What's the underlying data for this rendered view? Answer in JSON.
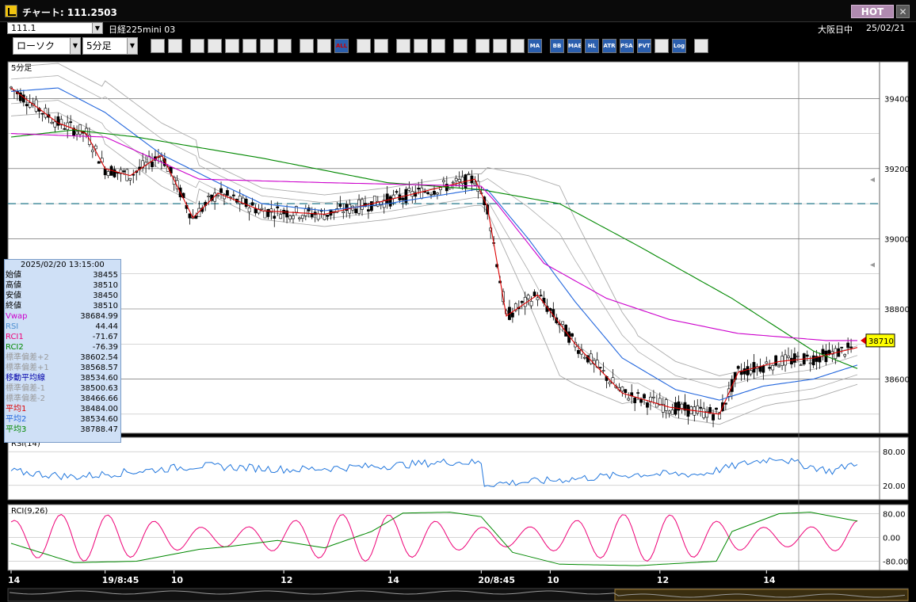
{
  "window": {
    "title": "チャート: 111.2503",
    "hot_label": "HOT",
    "close_label": "✕"
  },
  "info": {
    "symbol": "111.1",
    "contract": "日経225mini 03",
    "session": "大阪日中",
    "date": "25/02/21"
  },
  "toolbar": {
    "chart_type": "ローソク",
    "interval": "5分足",
    "buttons": [
      "zoom",
      "window",
      "draw-line",
      "link",
      "cursor",
      "arrow",
      "list",
      "trash",
      "move-left",
      "move-right",
      "ALL",
      "pin",
      "search",
      "compare",
      "plus",
      "blank",
      "settings",
      "wrench",
      "palette",
      "indicators",
      "MA",
      "BB",
      "MAE",
      "HL",
      "ATR",
      "PSAR",
      "PVT",
      "frame",
      "Log",
      "export"
    ],
    "button_labels": {
      "all": "ALL",
      "ma": "MA",
      "bb": "BB",
      "mae": "MAE",
      "hl": "HL",
      "atr": "ATR",
      "psar": "PSAR",
      "pvt": "PVT",
      "log": "Log"
    }
  },
  "colors": {
    "candle_up": "#ffffff",
    "candle_down": "#000000",
    "vwap": "#cc00cc",
    "ma1": "#dd0000",
    "ma2": "#2266dd",
    "ma3": "#008800",
    "bands": "#aaaaaa",
    "rsi": "#2277dd",
    "rci1": "#ee0077",
    "rci2": "#008800",
    "dashed_line": "#227788",
    "price_tag": "#ffff00"
  },
  "panels": {
    "main_label": "5分足",
    "rsi_label": "RSI(14)",
    "rci_label": "RCI(9,26)"
  },
  "price_tag": "38710",
  "info_panel": {
    "datetime": "2025/02/20  13:15:00",
    "rows": [
      {
        "label": "始値",
        "value": "38455",
        "color": "#000000"
      },
      {
        "label": "高値",
        "value": "38510",
        "color": "#000000"
      },
      {
        "label": "安値",
        "value": "38450",
        "color": "#000000"
      },
      {
        "label": "終値",
        "value": "38510",
        "color": "#000000"
      },
      {
        "label": "Vwap",
        "value": "38684.99",
        "color": "#cc00cc"
      },
      {
        "label": "RSI",
        "value": "44.44",
        "color": "#4c8fd0"
      },
      {
        "label": "RCI1",
        "value": "-71.67",
        "color": "#ee0077"
      },
      {
        "label": "RCI2",
        "value": "-76.39",
        "color": "#008800"
      },
      {
        "label": "標準偏差+2",
        "value": "38602.54",
        "color": "#999999"
      },
      {
        "label": "標準偏差+1",
        "value": "38568.57",
        "color": "#999999"
      },
      {
        "label": "移動平均線",
        "value": "38534.60",
        "color": "#0000aa"
      },
      {
        "label": "標準偏差-1",
        "value": "38500.63",
        "color": "#999999"
      },
      {
        "label": "標準偏差-2",
        "value": "38466.66",
        "color": "#999999"
      },
      {
        "label": "平均1",
        "value": "38484.00",
        "color": "#dd0000"
      },
      {
        "label": "平均2",
        "value": "38534.60",
        "color": "#2266dd"
      },
      {
        "label": "平均3",
        "value": "38788.47",
        "color": "#008800"
      }
    ]
  },
  "chart_data": [
    {
      "type": "candlestick",
      "title": "5分足",
      "ylim": [
        38450,
        39500
      ],
      "yticks": [
        "39400",
        "39200",
        "39000",
        "38800",
        "38600"
      ],
      "ytick_values": [
        39400,
        39200,
        39000,
        38800,
        38600
      ],
      "horizontal_line": 39100,
      "xtick_labels": [
        "14",
        "19/8:45",
        "10",
        "12",
        "14",
        "20/8:45",
        "10",
        "12",
        "14"
      ],
      "xtick_bar_index": [
        0,
        30,
        52,
        87,
        121,
        150,
        172,
        207,
        241
      ],
      "series": [
        {
          "name": "平均1",
          "color": "#dd0000",
          "anchors": [
            [
              0,
              39430
            ],
            [
              15,
              39330
            ],
            [
              24,
              39300
            ],
            [
              30,
              39200
            ],
            [
              38,
              39180
            ],
            [
              48,
              39240
            ],
            [
              58,
              39060
            ],
            [
              66,
              39130
            ],
            [
              80,
              39080
            ],
            [
              100,
              39070
            ],
            [
              120,
              39110
            ],
            [
              148,
              39170
            ],
            [
              152,
              39090
            ],
            [
              158,
              38780
            ],
            [
              168,
              38840
            ],
            [
              180,
              38700
            ],
            [
              195,
              38560
            ],
            [
              210,
              38520
            ],
            [
              226,
              38500
            ],
            [
              232,
              38620
            ],
            [
              245,
              38650
            ],
            [
              256,
              38660
            ],
            [
              270,
              38690
            ]
          ]
        },
        {
          "name": "平均2",
          "color": "#2266dd",
          "anchors": [
            [
              0,
              39420
            ],
            [
              15,
              39430
            ],
            [
              30,
              39360
            ],
            [
              48,
              39240
            ],
            [
              66,
              39160
            ],
            [
              80,
              39100
            ],
            [
              100,
              39080
            ],
            [
              120,
              39100
            ],
            [
              148,
              39140
            ],
            [
              152,
              39140
            ],
            [
              165,
              39000
            ],
            [
              180,
              38820
            ],
            [
              195,
              38660
            ],
            [
              212,
              38570
            ],
            [
              226,
              38540
            ],
            [
              240,
              38580
            ],
            [
              256,
              38600
            ],
            [
              270,
              38640
            ]
          ]
        },
        {
          "name": "平均3",
          "color": "#008800",
          "anchors": [
            [
              0,
              39290
            ],
            [
              20,
              39310
            ],
            [
              40,
              39290
            ],
            [
              80,
              39230
            ],
            [
              120,
              39160
            ],
            [
              150,
              39140
            ],
            [
              175,
              39100
            ],
            [
              200,
              38980
            ],
            [
              230,
              38830
            ],
            [
              256,
              38680
            ],
            [
              270,
              38630
            ]
          ]
        },
        {
          "name": "Vwap",
          "color": "#cc00cc",
          "anchors": [
            [
              0,
              39300
            ],
            [
              30,
              39290
            ],
            [
              60,
              39170
            ],
            [
              100,
              39160
            ],
            [
              150,
              39150
            ],
            [
              155,
              39100
            ],
            [
              170,
              38930
            ],
            [
              190,
              38830
            ],
            [
              210,
              38770
            ],
            [
              232,
              38730
            ],
            [
              260,
              38710
            ],
            [
              270,
              38710
            ]
          ]
        }
      ]
    },
    {
      "type": "line",
      "title": "RSI(14)",
      "ylim": [
        0,
        100
      ],
      "yticks": [
        "80.00",
        "20.00"
      ],
      "ytick_values": [
        80,
        20
      ],
      "series": [
        {
          "name": "RSI",
          "color": "#2277dd",
          "anchors": [
            [
              0,
              45
            ],
            [
              20,
              35
            ],
            [
              30,
              40
            ],
            [
              60,
              55
            ],
            [
              90,
              48
            ],
            [
              120,
              55
            ],
            [
              140,
              62
            ],
            [
              150,
              60
            ],
            [
              151,
              22
            ],
            [
              170,
              28
            ],
            [
              200,
              40
            ],
            [
              220,
              40
            ],
            [
              235,
              60
            ],
            [
              245,
              70
            ],
            [
              250,
              60
            ],
            [
              262,
              45
            ],
            [
              270,
              62
            ]
          ]
        }
      ]
    },
    {
      "type": "line",
      "title": "RCI(9,26)",
      "ylim": [
        -100,
        100
      ],
      "yticks": [
        "80.00",
        "0.00",
        "-80.00"
      ],
      "ytick_values": [
        80,
        0,
        -80
      ],
      "series": [
        {
          "name": "RCI1",
          "color": "#ee0077"
        },
        {
          "name": "RCI2",
          "color": "#008800",
          "anchors": [
            [
              0,
              -20
            ],
            [
              20,
              -85
            ],
            [
              40,
              -80
            ],
            [
              60,
              -40
            ],
            [
              70,
              -30
            ],
            [
              85,
              -10
            ],
            [
              100,
              -35
            ],
            [
              115,
              20
            ],
            [
              125,
              82
            ],
            [
              140,
              85
            ],
            [
              150,
              70
            ],
            [
              160,
              -50
            ],
            [
              175,
              -90
            ],
            [
              200,
              -95
            ],
            [
              225,
              -80
            ],
            [
              230,
              20
            ],
            [
              245,
              80
            ],
            [
              255,
              85
            ],
            [
              270,
              55
            ]
          ]
        }
      ]
    }
  ]
}
